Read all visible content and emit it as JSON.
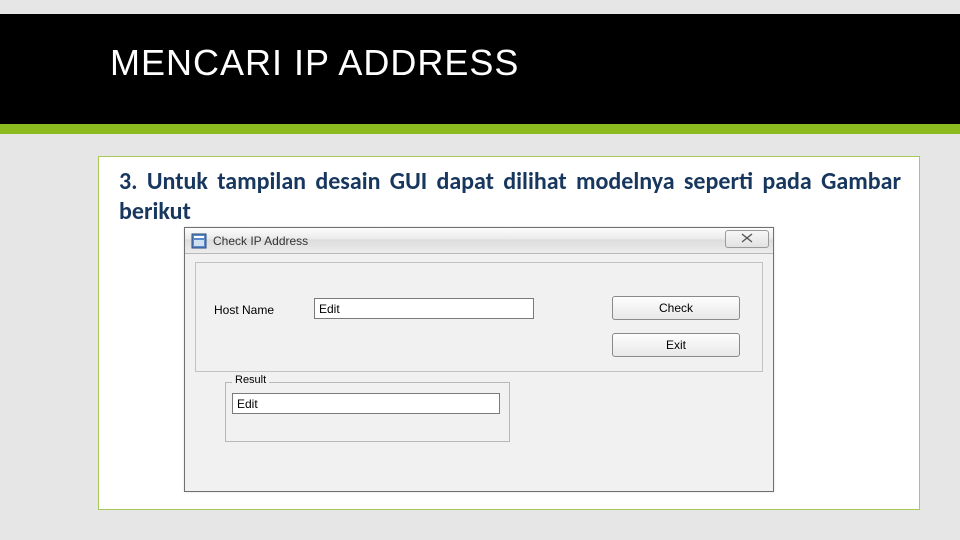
{
  "header": {
    "title": "MENCARI IP ADDRESS"
  },
  "step": {
    "text": "3. Untuk tampilan desain GUI dapat dilihat modelnya seperti pada Gambar berikut"
  },
  "window": {
    "title": "Check IP Address",
    "host_label": "Host Name",
    "host_value": "Edit",
    "check_label": "Check",
    "exit_label": "Exit",
    "result_legend": "Result",
    "result_value": "Edit"
  }
}
